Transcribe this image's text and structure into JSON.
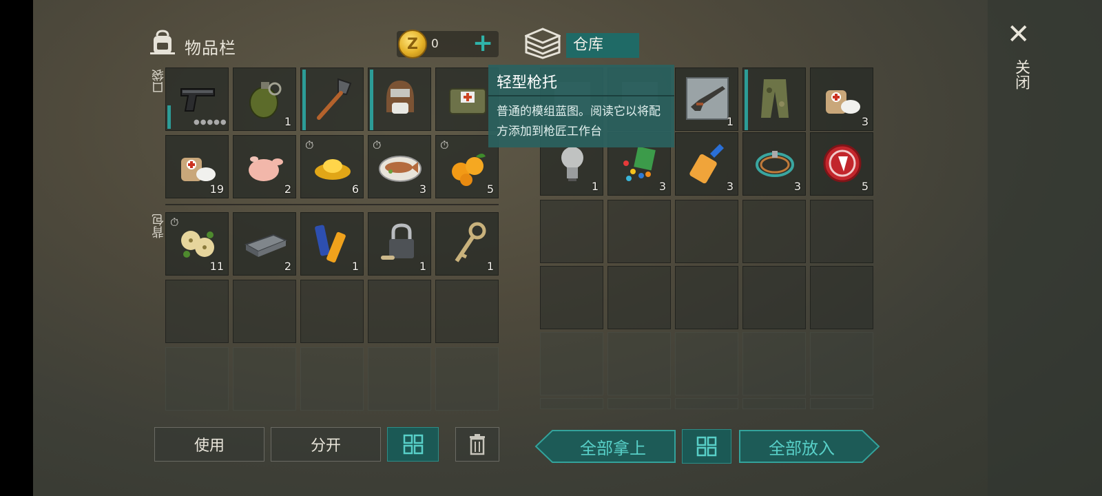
{
  "inventory": {
    "title": "物品栏",
    "coins": "0",
    "pocket_label": "口袋",
    "backpack_label": "背包"
  },
  "warehouse": {
    "title": "仓库"
  },
  "tooltip": {
    "title": "轻型枪托",
    "description": "普通的模组蓝图。阅读它以将配方添加到枪匠工作台"
  },
  "close_label": "关闭",
  "left_slots": [
    {
      "icon": "pistol-icon",
      "count": "",
      "bar": "short",
      "timer": false,
      "dots": true
    },
    {
      "icon": "grenade-icon",
      "count": "1",
      "bar": "",
      "timer": false
    },
    {
      "icon": "shovel-icon",
      "count": "",
      "bar": "full",
      "timer": false
    },
    {
      "icon": "fur-hat-icon",
      "count": "",
      "bar": "full",
      "timer": false
    },
    {
      "icon": "medical-bag-icon",
      "count": "",
      "bar": "",
      "timer": false
    },
    {
      "icon": "bandage-icon",
      "count": "19",
      "bar": "",
      "timer": false
    },
    {
      "icon": "raw-chicken-icon",
      "count": "2",
      "bar": "",
      "timer": false
    },
    {
      "icon": "gold-ingot-icon",
      "count": "6",
      "bar": "",
      "timer": true
    },
    {
      "icon": "fish-dish-icon",
      "count": "3",
      "bar": "",
      "timer": true
    },
    {
      "icon": "kumquat-icon",
      "count": "5",
      "bar": "",
      "timer": true
    },
    {
      "icon": "lotus-root-icon",
      "count": "11",
      "bar": "",
      "timer": true
    },
    {
      "icon": "iron-bar-icon",
      "count": "2",
      "bar": "",
      "timer": false
    },
    {
      "icon": "batteries-icon",
      "count": "1",
      "bar": "",
      "timer": false
    },
    {
      "icon": "padlock-icon",
      "count": "1",
      "bar": "",
      "timer": false
    },
    {
      "icon": "key-icon",
      "count": "1",
      "bar": "",
      "timer": false
    }
  ],
  "right_slots": [
    {
      "icon": "blueprint-icon",
      "count": "",
      "bar": ""
    },
    {
      "icon": "blueprint-icon",
      "count": "",
      "bar": ""
    },
    {
      "icon": "rifle-blueprint-icon",
      "count": "1",
      "bar": ""
    },
    {
      "icon": "camo-pants-icon",
      "count": "",
      "bar": "full"
    },
    {
      "icon": "bandage-icon",
      "count": "3",
      "bar": ""
    },
    {
      "icon": "light-bulb-icon",
      "count": "1",
      "bar": ""
    },
    {
      "icon": "plastic-scraps-icon",
      "count": "3",
      "bar": ""
    },
    {
      "icon": "glue-icon",
      "count": "3",
      "bar": ""
    },
    {
      "icon": "wire-icon",
      "count": "3",
      "bar": ""
    },
    {
      "icon": "bottle-cap-icon",
      "count": "5",
      "bar": ""
    }
  ],
  "buttons": {
    "use": "使用",
    "split": "分开",
    "take_all": "全部拿上",
    "put_all": "全部放入"
  }
}
